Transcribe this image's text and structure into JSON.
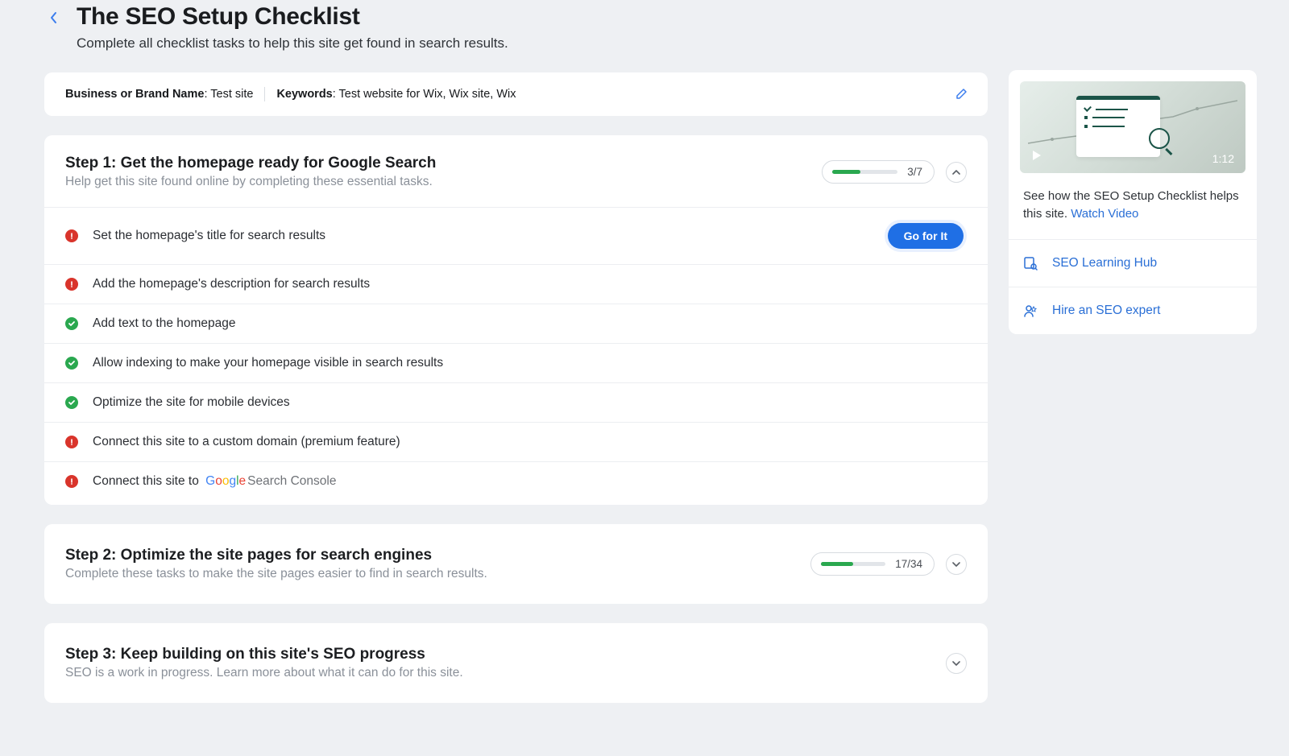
{
  "header": {
    "title": "The SEO Setup Checklist",
    "subtitle": "Complete all checklist tasks to help this site get found in search results."
  },
  "meta": {
    "business_label": "Business or Brand Name",
    "business_value": "Test site",
    "keywords_label": "Keywords",
    "keywords_value": "Test website for Wix, Wix site, Wix"
  },
  "step1": {
    "title": "Step 1: Get the homepage ready for Google Search",
    "subtitle": "Help get this site found online by completing these essential tasks.",
    "progress_text": "3/7",
    "progress_pct": 43,
    "tasks": {
      "t0": "Set the homepage's title for search results",
      "t1": "Add the homepage's description for search results",
      "t2": "Add text to the homepage",
      "t3": "Allow indexing to make your homepage visible in search results",
      "t4": "Optimize the site for mobile devices",
      "t5": "Connect this site to a custom domain (premium feature)",
      "t6_prefix": "Connect this site to",
      "t6_gsc": "Search Console"
    },
    "go_label": "Go for It"
  },
  "step2": {
    "title": "Step 2: Optimize the site pages for search engines",
    "subtitle": "Complete these tasks to make the site pages easier to find in search results.",
    "progress_text": "17/34",
    "progress_pct": 50
  },
  "step3": {
    "title": "Step 3: Keep building on this site's SEO progress",
    "subtitle": "SEO is a work in progress. Learn more about what it can do for this site."
  },
  "sidebar": {
    "duration": "1:12",
    "desc_text": "See how the SEO Setup Checklist helps this site. ",
    "watch_link": "Watch Video",
    "link1": "SEO Learning Hub",
    "link2": "Hire an SEO expert"
  }
}
